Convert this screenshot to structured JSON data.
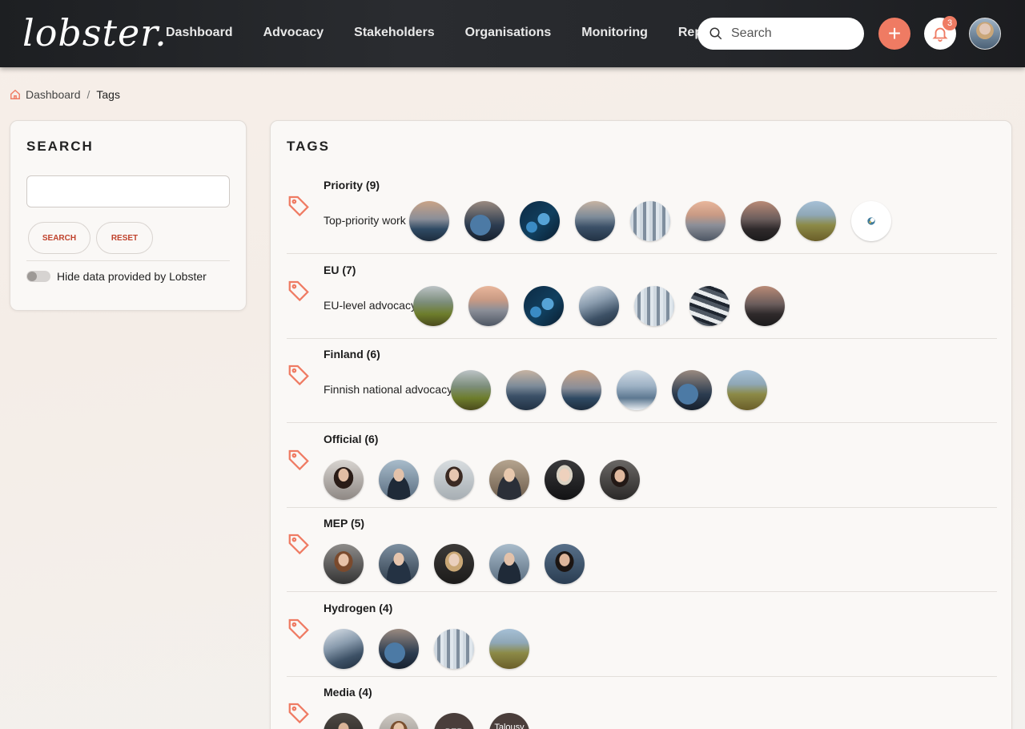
{
  "header": {
    "logo": "lobster.",
    "nav": [
      "Dashboard",
      "Advocacy",
      "Stakeholders",
      "Organisations",
      "Monitoring",
      "Reports"
    ],
    "search_placeholder": "Search",
    "add_label": "+",
    "notification_count": "3"
  },
  "breadcrumb": {
    "home": "Dashboard",
    "separator": "/",
    "current": "Tags"
  },
  "search_panel": {
    "title": "SEARCH",
    "input_value": "",
    "search_button": "SEARCH",
    "reset_button": "RESET",
    "toggle_label": "Hide data provided by Lobster",
    "toggle_on": false
  },
  "tags_panel": {
    "title": "TAGS",
    "tags": [
      {
        "name": "Priority (9)",
        "description": "Top-priority work",
        "avatars": [
          "g-sea",
          "g-river",
          "g-tech",
          "g-coast",
          "g-lab",
          "g-sunset",
          "g-dusk",
          "g-field",
          "logo"
        ]
      },
      {
        "name": "EU (7)",
        "description": "EU-level advocacy",
        "avatars": [
          "g-green",
          "g-sunset",
          "g-tech",
          "g-road",
          "g-lab",
          "g-tanks",
          "g-dusk"
        ]
      },
      {
        "name": "Finland (6)",
        "description": "Finnish national advocacy",
        "avatars": [
          "g-green",
          "g-coast",
          "g-sea",
          "g-bay",
          "g-river",
          "g-field"
        ]
      },
      {
        "name": "Official (6)",
        "description": "",
        "avatars": [
          "p-1",
          "p-2",
          "p-3",
          "p-4",
          "p-5",
          "p-6"
        ]
      },
      {
        "name": "MEP (5)",
        "description": "",
        "avatars": [
          "p-7",
          "p-8",
          "p-9",
          "p-2",
          "p-10"
        ]
      },
      {
        "name": "Hydrogen (4)",
        "description": "",
        "avatars": [
          "g-road",
          "g-river",
          "g-lab",
          "g-field"
        ]
      },
      {
        "name": "Media (4)",
        "description": "",
        "avatars": [
          "p-11",
          "p-12",
          "BER",
          "Talousv iesti"
        ]
      }
    ]
  },
  "colors": {
    "accent": "#ef7b63",
    "header_bg": "#25272b",
    "button_text": "#c0432d"
  },
  "icons": [
    "search-icon",
    "plus-icon",
    "bell-icon",
    "home-icon",
    "tag-icon"
  ]
}
